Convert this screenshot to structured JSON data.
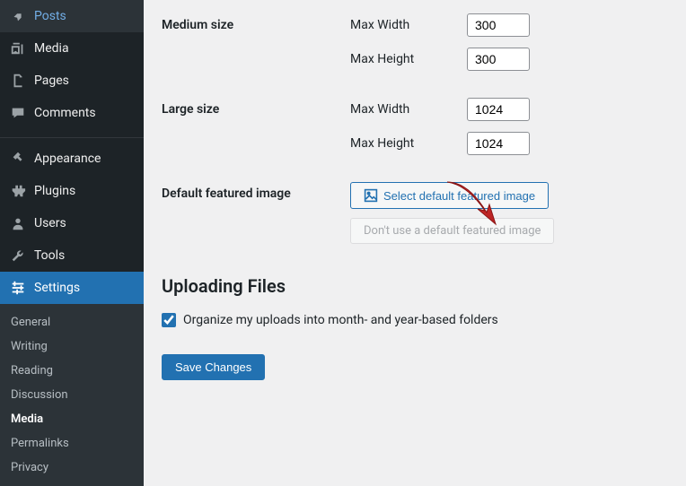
{
  "sidebar": {
    "items": [
      {
        "label": "Posts"
      },
      {
        "label": "Media"
      },
      {
        "label": "Pages"
      },
      {
        "label": "Comments"
      },
      {
        "label": "Appearance"
      },
      {
        "label": "Plugins"
      },
      {
        "label": "Users"
      },
      {
        "label": "Tools"
      },
      {
        "label": "Settings"
      }
    ],
    "submenu": [
      "General",
      "Writing",
      "Reading",
      "Discussion",
      "Media",
      "Permalinks",
      "Privacy"
    ]
  },
  "form": {
    "medium_label": "Medium size",
    "large_label": "Large size",
    "max_width_label": "Max Width",
    "max_height_label": "Max Height",
    "medium_width": "300",
    "medium_height": "300",
    "large_width": "1024",
    "large_height": "1024",
    "featured_label": "Default featured image",
    "select_btn": "Select default featured image",
    "disable_btn": "Don't use a default featured image",
    "uploading_heading": "Uploading Files",
    "organize_label": "Organize my uploads into month- and year-based folders",
    "save_btn": "Save Changes"
  }
}
